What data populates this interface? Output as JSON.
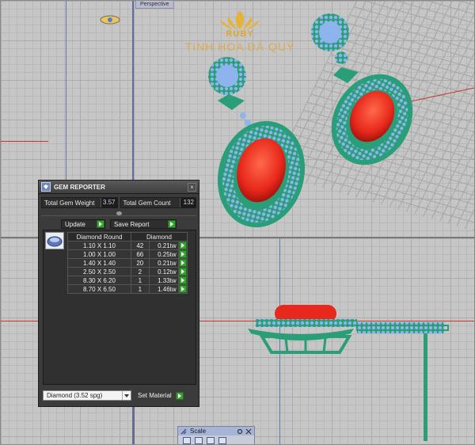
{
  "viewports": {
    "perspective_label": "Perspective"
  },
  "logo": {
    "name": "RUBY",
    "tagline": "TINH HOA ĐÁ QUÝ"
  },
  "gem_reporter": {
    "title": "GEM REPORTER",
    "close_icon": "×",
    "total_weight_label": "Total Gem Weight",
    "total_weight_value": "3.57",
    "total_count_label": "Total Gem Count",
    "total_count_value": "132",
    "update_label": "Update",
    "save_report_label": "Save Report",
    "table": {
      "headers": [
        "Diamond Round",
        "Diamond"
      ],
      "rows": [
        {
          "size": "1.10 X 1.10",
          "count": "42",
          "weight": "0.21tw"
        },
        {
          "size": "1.00 X 1.00",
          "count": "66",
          "weight": "0.25tw"
        },
        {
          "size": "1.40 X 1.40",
          "count": "20",
          "weight": "0.21tw"
        },
        {
          "size": "2.50 X 2.50",
          "count": "2",
          "weight": "0.12tw"
        },
        {
          "size": "8.30 X 6.20",
          "count": "1",
          "weight": "1.33tw"
        },
        {
          "size": "8.70 X 6.50",
          "count": "1",
          "weight": "1.46tw"
        }
      ]
    },
    "material_value": "Diamond      (3.52 spg)",
    "set_material_label": "Set Material"
  },
  "scale_panel": {
    "title": "Scale"
  },
  "colors": {
    "metal": "#2a9e78",
    "ruby": "#e8281c",
    "accent_stone": "#8db4ec",
    "button_green": "#37a232",
    "panel_bg": "#3b3b3b"
  },
  "icons": [
    "gem-reporter-icon",
    "close-icon",
    "play-icon",
    "dropdown-arrow-icon",
    "scale-icon"
  ]
}
